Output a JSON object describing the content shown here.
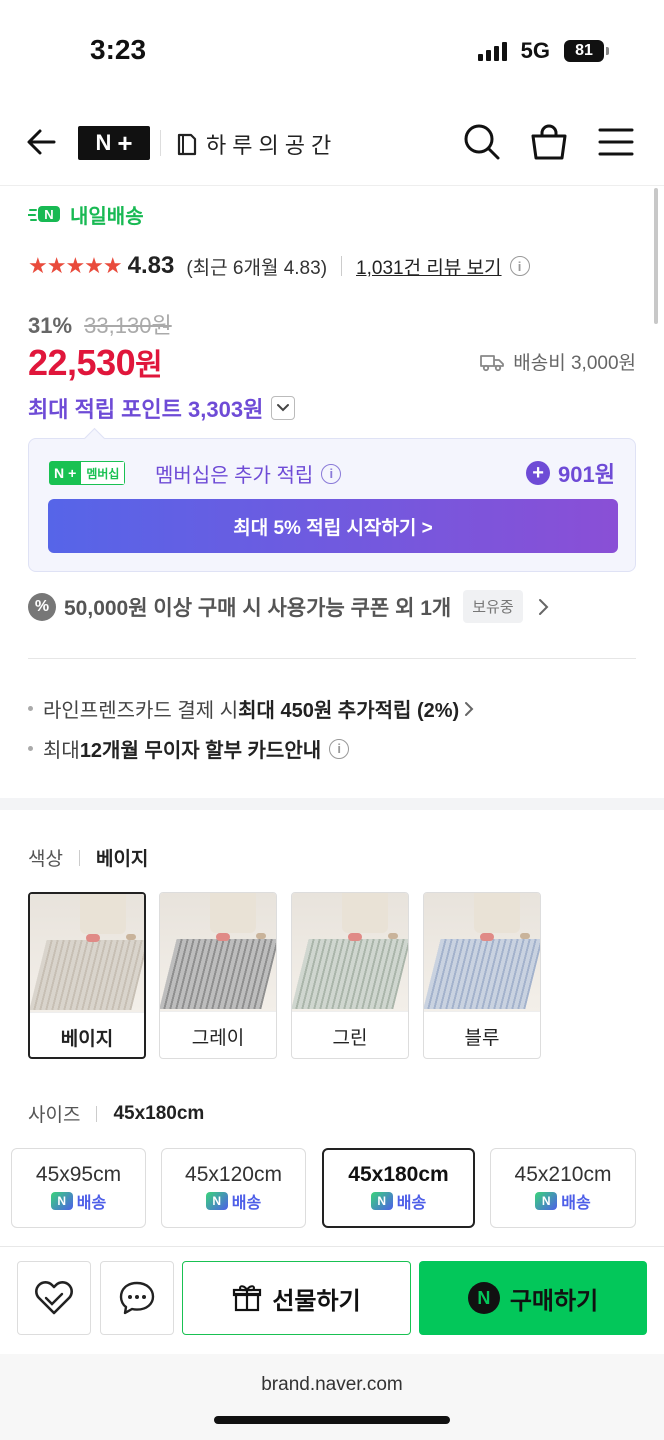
{
  "status": {
    "time": "3:23",
    "network": "5G",
    "battery": "81"
  },
  "header": {
    "brand_badge": "N",
    "store_name": "하루의공간"
  },
  "delivery": {
    "label": "내일배송"
  },
  "rating": {
    "stars": "★★★★★",
    "score": "4.83",
    "recent": "(최근 6개월 4.83)",
    "reviews_link": "1,031건 리뷰 보기"
  },
  "price": {
    "discount": "31%",
    "original": "33,130원",
    "current": "22,530",
    "currency": "원",
    "shipping": "배송비 3,000원"
  },
  "points": {
    "label": "최대 적립 포인트 3,303원"
  },
  "membership": {
    "badge_label": "멤버십",
    "text": "멤버십은 추가 적립",
    "amount": "901원",
    "cta": "최대 5% 적립 시작하기 >"
  },
  "coupon": {
    "icon": "%",
    "text": "50,000원 이상 구매 시 사용가능 쿠폰 외 1개",
    "badge": "보유중"
  },
  "card_info": {
    "line1_prefix": "라인프렌즈카드 결제 시 ",
    "line1_bold": "최대 450원 추가적립 (2%)",
    "line2_prefix": "최대 ",
    "line2_bold": "12개월 무이자 할부 카드안내"
  },
  "color_option": {
    "label": "색상",
    "selected": "베이지",
    "items": [
      {
        "label": "베이지",
        "mat_color": "#d9d4cc",
        "stripe_color": "#c7bfb4"
      },
      {
        "label": "그레이",
        "mat_color": "#bdbdbd",
        "stripe_color": "#8f8f8f"
      },
      {
        "label": "그린",
        "mat_color": "#cfd6cf",
        "stripe_color": "#aab5aa"
      },
      {
        "label": "블루",
        "mat_color": "#c9d2e0",
        "stripe_color": "#a3b2cc"
      }
    ]
  },
  "size_option": {
    "label": "사이즈",
    "selected": "45x180cm",
    "items": [
      {
        "label": "45x95cm",
        "ship": "배송"
      },
      {
        "label": "45x120cm",
        "ship": "배송"
      },
      {
        "label": "45x180cm",
        "ship": "배송"
      },
      {
        "label": "45x210cm",
        "ship": "배송"
      }
    ]
  },
  "bottom_bar": {
    "gift": "선물하기",
    "buy": "구매하기",
    "buy_logo": "N"
  },
  "browser": {
    "url": "brand.naver.com"
  }
}
